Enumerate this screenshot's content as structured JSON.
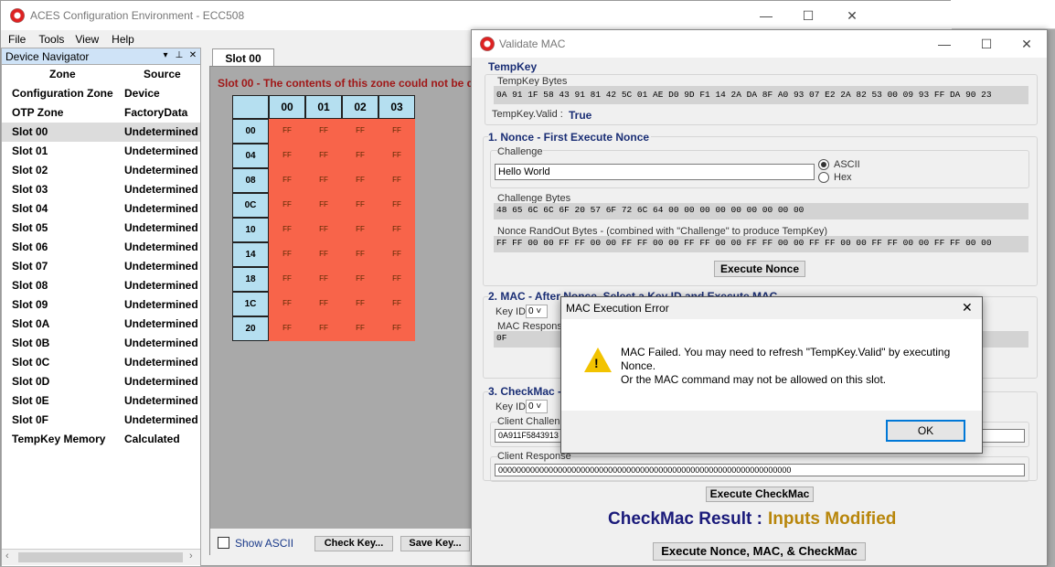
{
  "main_window": {
    "title": "ACES Configuration Environment - ECC508",
    "menu": [
      "File",
      "Tools",
      "View",
      "Help"
    ]
  },
  "navigator": {
    "title": "Device Navigator",
    "columns": {
      "zone": "Zone",
      "source": "Source"
    },
    "rows": [
      {
        "zone": "Configuration Zone",
        "source": "Device"
      },
      {
        "zone": "OTP Zone",
        "source": "FactoryData"
      },
      {
        "zone": "Slot 00",
        "source": "Undetermined"
      },
      {
        "zone": "Slot 01",
        "source": "Undetermined"
      },
      {
        "zone": "Slot 02",
        "source": "Undetermined"
      },
      {
        "zone": "Slot 03",
        "source": "Undetermined"
      },
      {
        "zone": "Slot 04",
        "source": "Undetermined"
      },
      {
        "zone": "Slot 05",
        "source": "Undetermined"
      },
      {
        "zone": "Slot 06",
        "source": "Undetermined"
      },
      {
        "zone": "Slot 07",
        "source": "Undetermined"
      },
      {
        "zone": "Slot 08",
        "source": "Undetermined"
      },
      {
        "zone": "Slot 09",
        "source": "Undetermined"
      },
      {
        "zone": "Slot 0A",
        "source": "Undetermined"
      },
      {
        "zone": "Slot 0B",
        "source": "Undetermined"
      },
      {
        "zone": "Slot 0C",
        "source": "Undetermined"
      },
      {
        "zone": "Slot 0D",
        "source": "Undetermined"
      },
      {
        "zone": "Slot 0E",
        "source": "Undetermined"
      },
      {
        "zone": "Slot 0F",
        "source": "Undetermined"
      },
      {
        "zone": "TempKey Memory",
        "source": "Calculated"
      }
    ],
    "selected": "Slot 00"
  },
  "slot_panel": {
    "tab": "Slot 00",
    "message": "Slot 00 - The contents of this zone could not be d",
    "col_headers": [
      "00",
      "01",
      "02",
      "03"
    ],
    "row_headers": [
      "00",
      "04",
      "08",
      "0C",
      "10",
      "14",
      "18",
      "1C",
      "20"
    ],
    "cell_value": "FF",
    "show_ascii": "Show ASCII",
    "check_key": "Check Key...",
    "save_key": "Save Key..."
  },
  "validate_mac": {
    "title": "Validate MAC",
    "tempkey": {
      "title": "TempKey",
      "bytes_label": "TempKey Bytes",
      "bytes": "0A 91 1F 58 43 91 81 42 5C 01 AE D0 9D F1 14 2A DA 8F A0 93 07 E2 2A 82 53 00 09 93 FF DA 90 23",
      "valid_label": "TempKey.Valid :",
      "valid_value": "True"
    },
    "nonce": {
      "title": "1. Nonce - First Execute Nonce",
      "challenge_label": "Challenge",
      "challenge_value": "Hello World",
      "ascii": "ASCII",
      "hex": "Hex",
      "challenge_bytes_label": "Challenge Bytes",
      "challenge_bytes": "48 65 6C 6C 6F 20 57 6F 72 6C 64 00 00 00 00 00 00 00 00 00",
      "randout_label": "Nonce RandOut Bytes - (combined with \"Challenge\" to produce TempKey)",
      "randout": "FF FF 00 00 FF FF 00 00 FF FF 00 00 FF FF 00 00 FF FF 00 00 FF FF 00 00 FF FF 00 00 FF FF 00 00",
      "execute": "Execute Nonce"
    },
    "mac": {
      "title": "2. MAC - After Nonce, Select a Key ID and Execute MAC",
      "keyid_label": "Key ID",
      "keyid_value": "0",
      "response_label": "MAC Response",
      "response_value": "0F"
    },
    "checkmac": {
      "title": "3. CheckMac -",
      "keyid_label": "Key ID",
      "keyid_value": "0",
      "client_challenge_label": "Client Challeng",
      "client_challenge_value": "0A911F5843913",
      "client_response_label": "Client Response",
      "client_response_value": "0000000000000000000000000000000000000000000000000000000000000000",
      "execute": "Execute CheckMac",
      "result_label": "CheckMac Result :",
      "result_value": "Inputs Modified",
      "execute_all": "Execute Nonce, MAC, & CheckMac"
    }
  },
  "error_dialog": {
    "title": "MAC Execution Error",
    "line1": "MAC Failed. You may need to refresh \"TempKey.Valid\" by executing",
    "line2": "Nonce.",
    "line3": "Or the MAC command may not be allowed on this slot.",
    "ok": "OK"
  },
  "colors": {
    "cell_fill": "#f8644a",
    "header_fill": "#b5dff0",
    "result_value": "#b8860b",
    "section_title": "#1a2e75",
    "slot_message": "#a01818"
  }
}
